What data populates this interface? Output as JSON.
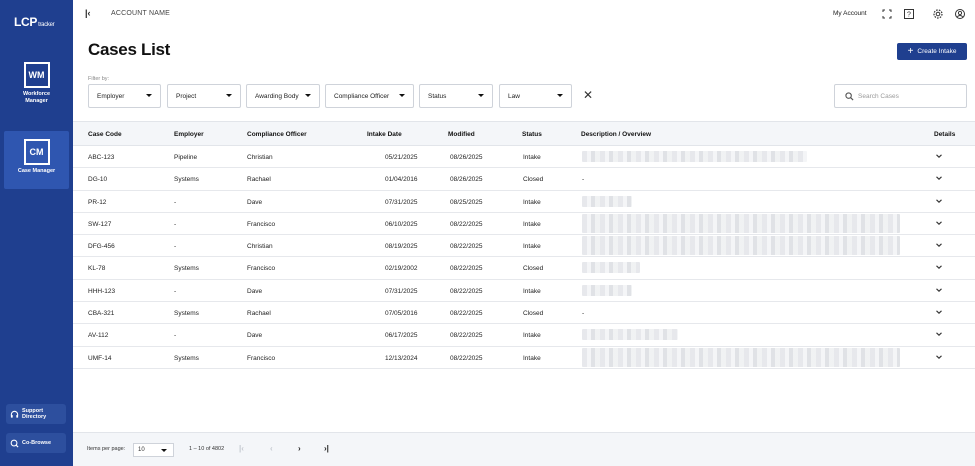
{
  "brand": {
    "logo_main": "LCP",
    "logo_sub": "tracker"
  },
  "sidebar": {
    "apps": [
      {
        "badge": "WM",
        "label_line1": "Workforce",
        "label_line2": "Manager"
      },
      {
        "badge": "CM",
        "label_line1": "Case Manager",
        "label_line2": ""
      }
    ],
    "support_label_line1": "Support",
    "support_label_line2": "Directory",
    "cobrowse_label": "Co-Browse"
  },
  "topbar": {
    "account_name": "ACCOUNT NAME",
    "my_account": "My Account"
  },
  "page": {
    "title": "Cases List",
    "create_button": "Create Intake",
    "filter_by": "Filter by:",
    "filters": [
      "Employer",
      "Project",
      "Awarding Body",
      "Compliance Officer",
      "Status",
      "Law"
    ],
    "search_placeholder": "Search Cases"
  },
  "table": {
    "columns": [
      "Case Code",
      "Employer",
      "Compliance Officer",
      "Intake Date",
      "Modified",
      "Status",
      "Description / Overview",
      "Details"
    ],
    "rows": [
      {
        "code": "ABC-123",
        "employer": "Pipeline",
        "officer": "Christian",
        "intake": "05/21/2025",
        "modified": "08/26/2025",
        "status": "Intake",
        "description": ""
      },
      {
        "code": "DG-10",
        "employer": "Systems",
        "officer": "Rachael",
        "intake": "01/04/2016",
        "modified": "08/26/2025",
        "status": "Closed",
        "description": "-"
      },
      {
        "code": "PR-12",
        "employer": "-",
        "officer": "Dave",
        "intake": "07/31/2025",
        "modified": "08/25/2025",
        "status": "Intake",
        "description": ""
      },
      {
        "code": "SW-127",
        "employer": "-",
        "officer": "Francisco",
        "intake": "06/10/2025",
        "modified": "08/22/2025",
        "status": "Intake",
        "description": ""
      },
      {
        "code": "DFG-456",
        "employer": "-",
        "officer": "Christian",
        "intake": "08/19/2025",
        "modified": "08/22/2025",
        "status": "Intake",
        "description": ""
      },
      {
        "code": "KL-78",
        "employer": "Systems",
        "officer": "Francisco",
        "intake": "02/19/2002",
        "modified": "08/22/2025",
        "status": "Closed",
        "description": ""
      },
      {
        "code": "HHH-123",
        "employer": "-",
        "officer": "Dave",
        "intake": "07/31/2025",
        "modified": "08/22/2025",
        "status": "Intake",
        "description": ""
      },
      {
        "code": "CBA-321",
        "employer": "Systems",
        "officer": "Rachael",
        "intake": "07/05/2016",
        "modified": "08/22/2025",
        "status": "Closed",
        "description": "-"
      },
      {
        "code": "AV-112",
        "employer": "-",
        "officer": "Dave",
        "intake": "06/17/2025",
        "modified": "08/22/2025",
        "status": "Intake",
        "description": ""
      },
      {
        "code": "UMF-14",
        "employer": "Systems",
        "officer": "Francisco",
        "intake": "12/13/2024",
        "modified": "08/22/2025",
        "status": "Intake",
        "description": ""
      }
    ]
  },
  "pagination": {
    "items_per_page_label": "Items per page:",
    "items_per_page": "10",
    "range_text": "1 – 10 of 4802"
  },
  "colors": {
    "brand": "#1f3f8f",
    "brand_light": "#2f56b0",
    "header_bg": "#f4f6f9"
  }
}
